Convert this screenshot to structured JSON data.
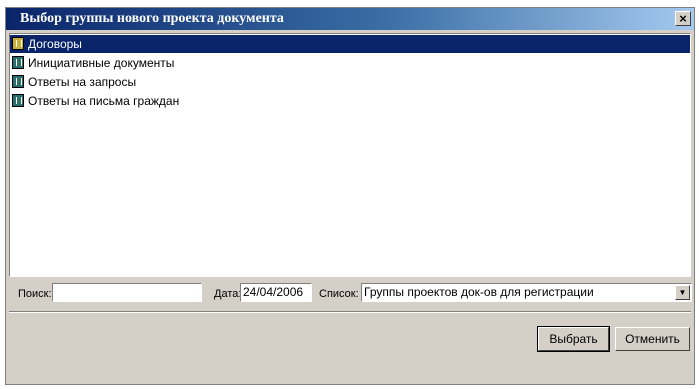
{
  "window": {
    "title": "Выбор группы нового проекта документа",
    "close_label": "×"
  },
  "list": {
    "items": [
      {
        "label": "Договоры",
        "selected": true
      },
      {
        "label": "Инициативные документы",
        "selected": false
      },
      {
        "label": "Ответы на запросы",
        "selected": false
      },
      {
        "label": "Ответы на письма граждан",
        "selected": false
      }
    ]
  },
  "filters": {
    "search_label": "Поиск:",
    "search_value": "",
    "date_label": "Дата:",
    "date_value": "24/04/2006",
    "list_label": "Список:",
    "list_value": "Группы проектов док-ов для регистрации"
  },
  "buttons": {
    "select_label": "Выбрать",
    "cancel_label": "Отменить"
  },
  "colors": {
    "selection": "#0a246a",
    "dialog_bg": "#d4d0c8",
    "title_gradient_start": "#0a246a"
  }
}
